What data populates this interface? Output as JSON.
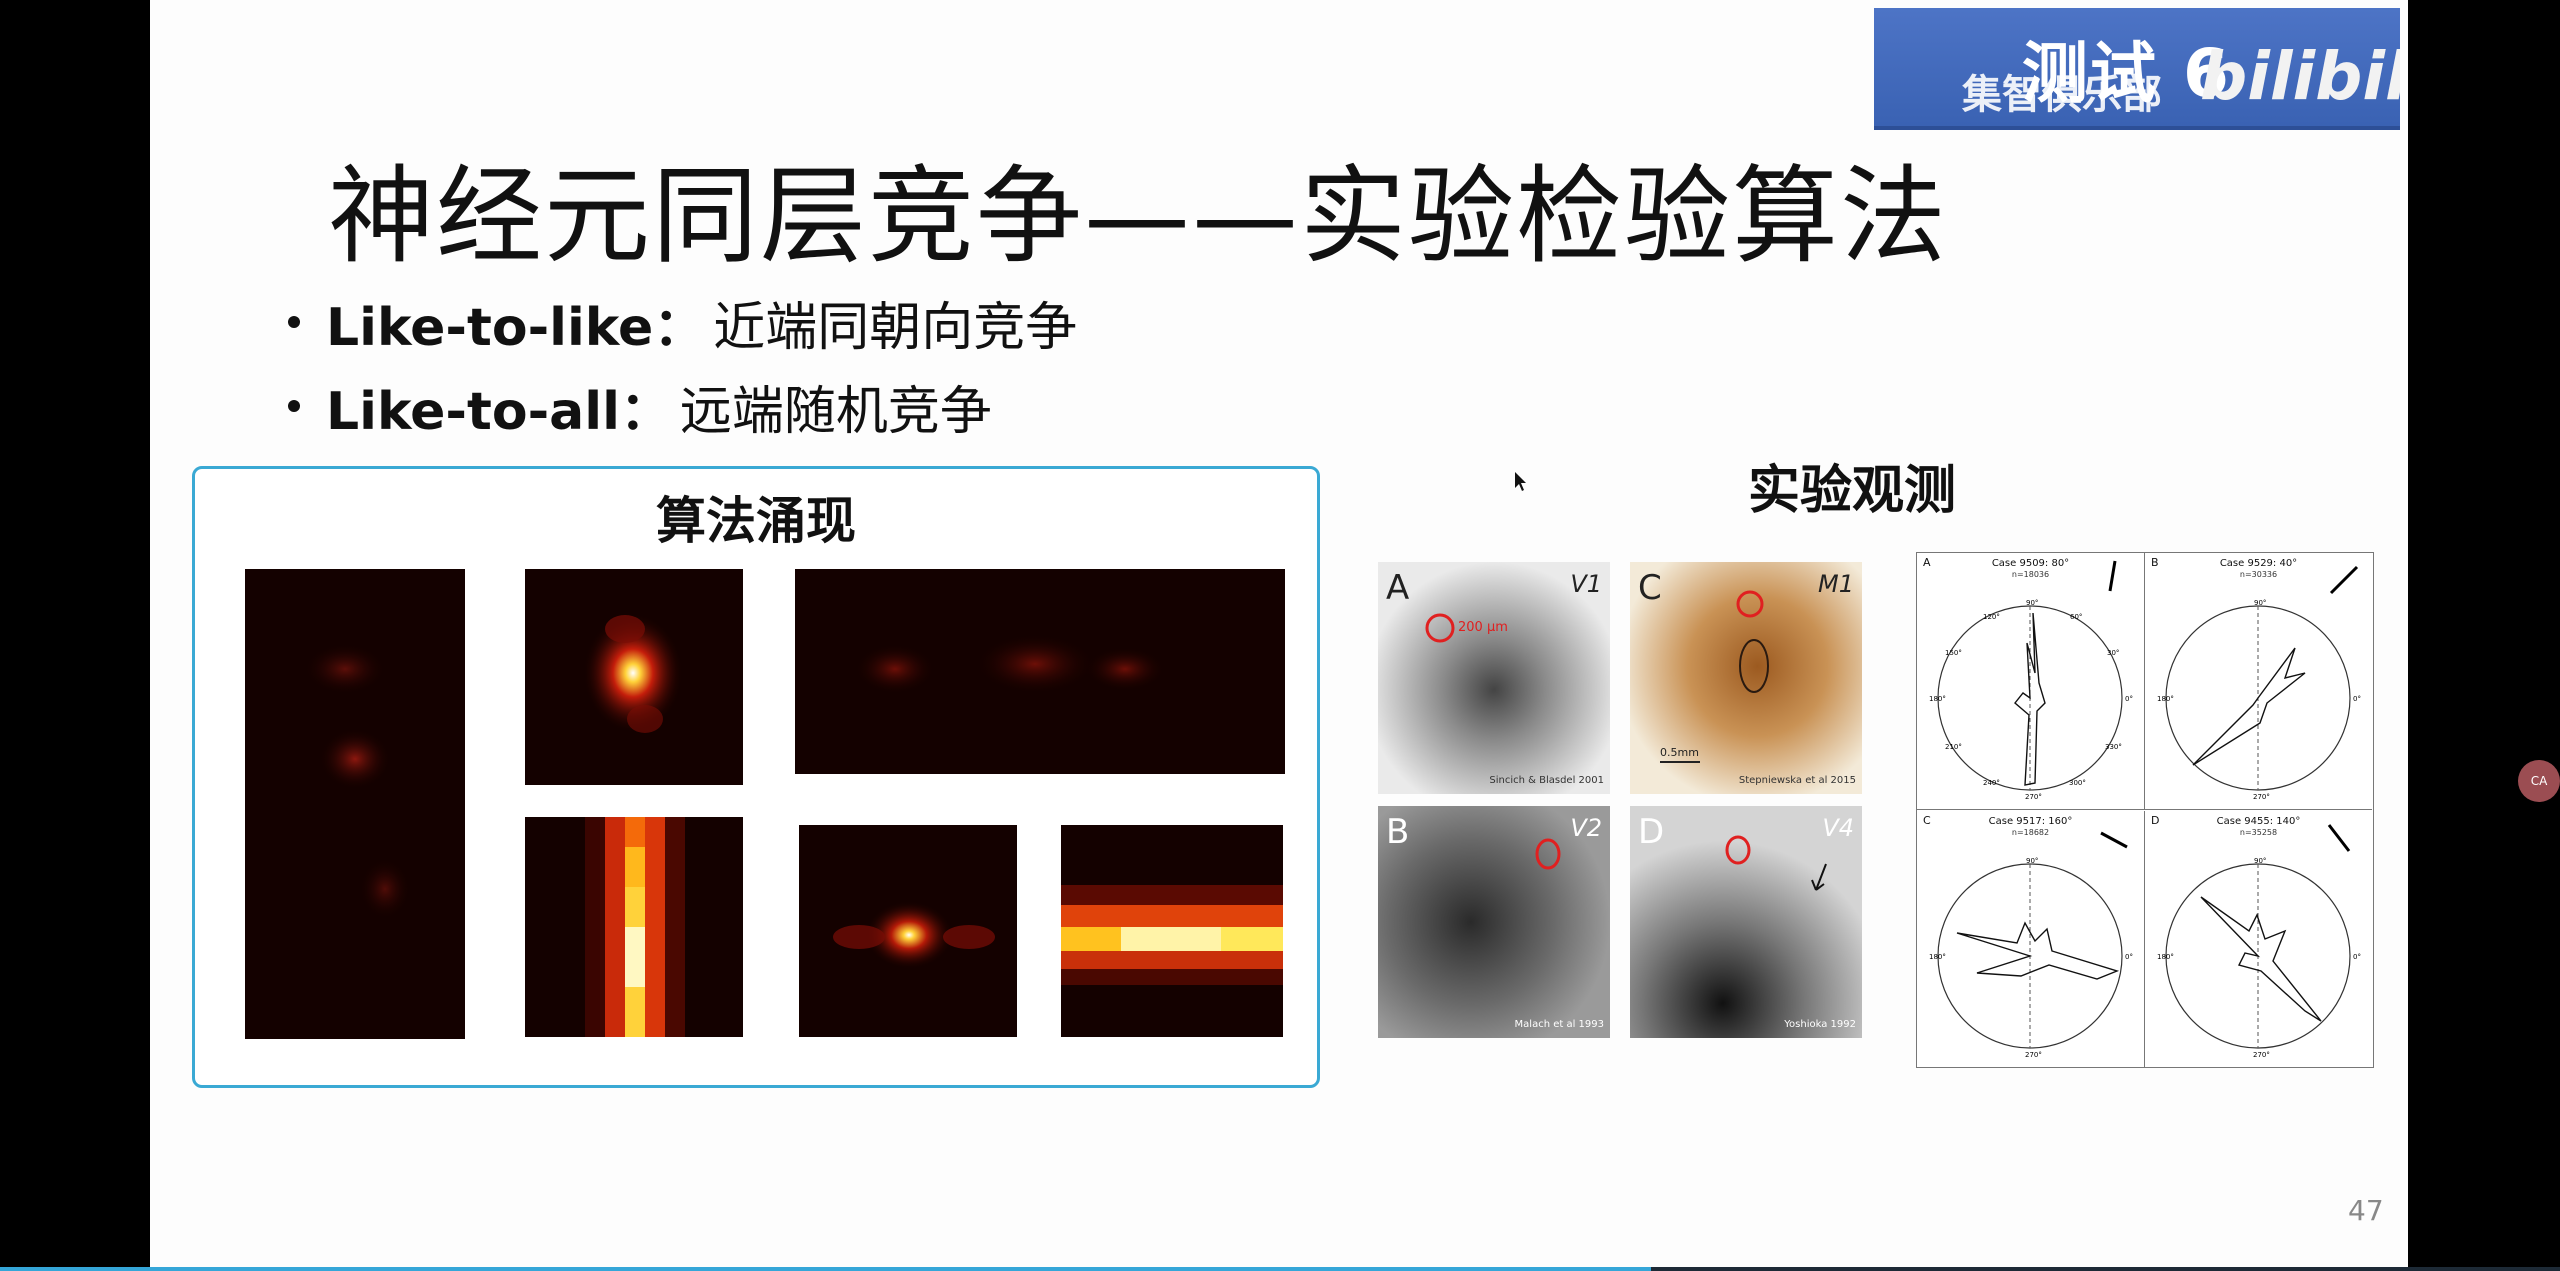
{
  "slide": {
    "title": "神经元同层竞争——实验检验算法",
    "bullets": [
      {
        "key": "Like-to-like：",
        "value": "近端同朝向竞争"
      },
      {
        "key": "Like-to-all：",
        "value": " 远端随机竞争"
      }
    ],
    "algo_title": "算法涌现",
    "exp_title": "实验观测",
    "page_number": "47"
  },
  "photos": [
    {
      "label": "A",
      "area": "V1",
      "scale": "200 μm",
      "citation": "Sincich & Blasdel 2001"
    },
    {
      "label": "C",
      "area": "M1",
      "scale": "0.5mm",
      "citation": "Stepniewska et al 2015"
    },
    {
      "label": "B",
      "area": "V2",
      "citation": "Malach et al 1993"
    },
    {
      "label": "D",
      "area": "V4",
      "citation": "Yoshioka 1992"
    }
  ],
  "polar_plots": [
    {
      "label": "A",
      "case": "Case 9509: 80°",
      "n": "n=18036"
    },
    {
      "label": "B",
      "case": "Case 9529: 40°",
      "n": "n=30336"
    },
    {
      "label": "C",
      "case": "Case 9517: 160°",
      "n": "n=18682"
    },
    {
      "label": "D",
      "case": "Case 9455: 140°",
      "n": "n=35258"
    }
  ],
  "polar_angles": [
    "90°",
    "120°",
    "60°",
    "150°",
    "30°",
    "180°",
    "0°",
    "210°",
    "330°",
    "240°",
    "300°",
    "270°"
  ],
  "watermark": {
    "org": "集智俱乐部",
    "test": "测试 6",
    "logo": "bilibili"
  },
  "side_button": {
    "label": "CA"
  },
  "progress": {
    "fraction": 0.645
  },
  "colors": {
    "box_border": "#3aa9d4",
    "watermark_bg": "#4d74c6",
    "progress": "#35a6d8",
    "heatmap_hot": "#ffe85a"
  }
}
